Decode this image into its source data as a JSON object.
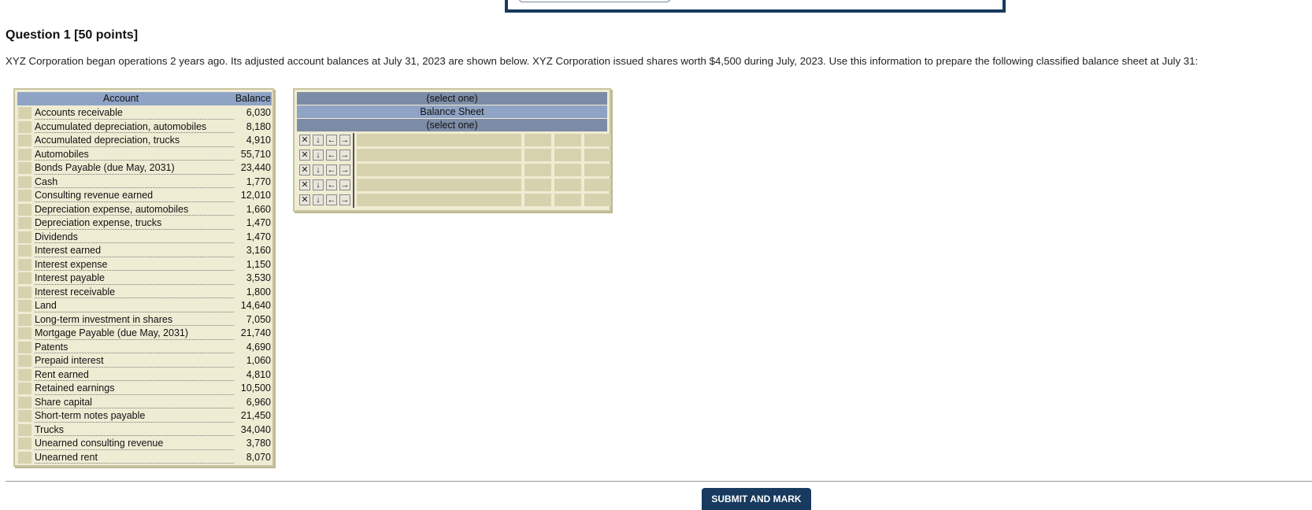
{
  "question": {
    "title": "Question 1 [50 points]",
    "text": "XYZ Corporation began operations 2 years ago. Its adjusted account balances at July 31, 2023 are shown below. XYZ Corporation issued shares worth $4,500 during July, 2023. Use this information to prepare the following classified balance sheet at July 31:"
  },
  "accounts": {
    "header_account": "Account",
    "header_balance": "Balance",
    "rows": [
      {
        "name": "Accounts receivable",
        "balance": "6,030"
      },
      {
        "name": "Accumulated depreciation, automobiles",
        "balance": "8,180"
      },
      {
        "name": "Accumulated depreciation, trucks",
        "balance": "4,910"
      },
      {
        "name": "Automobiles",
        "balance": "55,710"
      },
      {
        "name": "Bonds Payable (due May, 2031)",
        "balance": "23,440"
      },
      {
        "name": "Cash",
        "balance": "1,770"
      },
      {
        "name": "Consulting revenue earned",
        "balance": "12,010"
      },
      {
        "name": "Depreciation expense, automobiles",
        "balance": "1,660"
      },
      {
        "name": "Depreciation expense, trucks",
        "balance": "1,470"
      },
      {
        "name": "Dividends",
        "balance": "1,470"
      },
      {
        "name": "Interest earned",
        "balance": "3,160"
      },
      {
        "name": "Interest expense",
        "balance": "1,150"
      },
      {
        "name": "Interest payable",
        "balance": "3,530"
      },
      {
        "name": "Interest receivable",
        "balance": "1,800"
      },
      {
        "name": "Land",
        "balance": "14,640"
      },
      {
        "name": "Long-term investment in shares",
        "balance": "7,050"
      },
      {
        "name": "Mortgage Payable (due May, 2031)",
        "balance": "21,740"
      },
      {
        "name": "Patents",
        "balance": "4,690"
      },
      {
        "name": "Prepaid interest",
        "balance": "1,060"
      },
      {
        "name": "Rent earned",
        "balance": "4,810"
      },
      {
        "name": "Retained earnings",
        "balance": "10,500"
      },
      {
        "name": "Share capital",
        "balance": "6,960"
      },
      {
        "name": "Short-term notes payable",
        "balance": "21,450"
      },
      {
        "name": "Trucks",
        "balance": "34,040"
      },
      {
        "name": "Unearned consulting revenue",
        "balance": "3,780"
      },
      {
        "name": "Unearned rent",
        "balance": "8,070"
      }
    ]
  },
  "balance_sheet": {
    "header_company": "(select one)",
    "header_title": "Balance Sheet",
    "header_date": "(select one)",
    "row_controls": [
      "✕",
      "↓",
      "←",
      "→"
    ],
    "row_count": 5
  },
  "submit_label": "SUBMIT AND MARK"
}
